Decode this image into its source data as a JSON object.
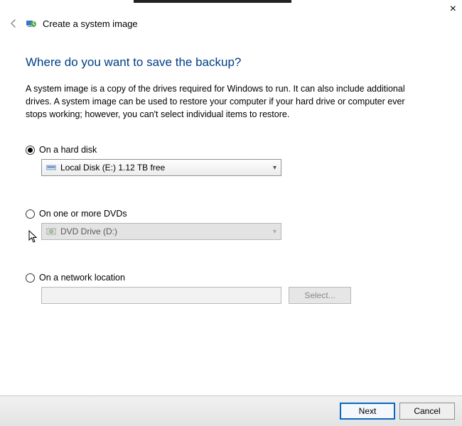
{
  "window": {
    "title": "Create a system image",
    "close_glyph": "×"
  },
  "page": {
    "heading": "Where do you want to save the backup?",
    "description": "A system image is a copy of the drives required for Windows to run. It can also include additional drives. A system image can be used to restore your computer if your hard drive or computer ever stops working; however, you can't select individual items to restore."
  },
  "options": {
    "hard_disk": {
      "label": "On a hard disk",
      "selected": true,
      "combo_text": "Local Disk (E:)  1.12 TB free"
    },
    "dvd": {
      "label": "On one or more DVDs",
      "selected": false,
      "combo_text": "DVD Drive (D:)"
    },
    "network": {
      "label": "On a network location",
      "selected": false,
      "input_value": "",
      "select_button": "Select..."
    }
  },
  "buttons": {
    "next": "Next",
    "cancel": "Cancel"
  }
}
